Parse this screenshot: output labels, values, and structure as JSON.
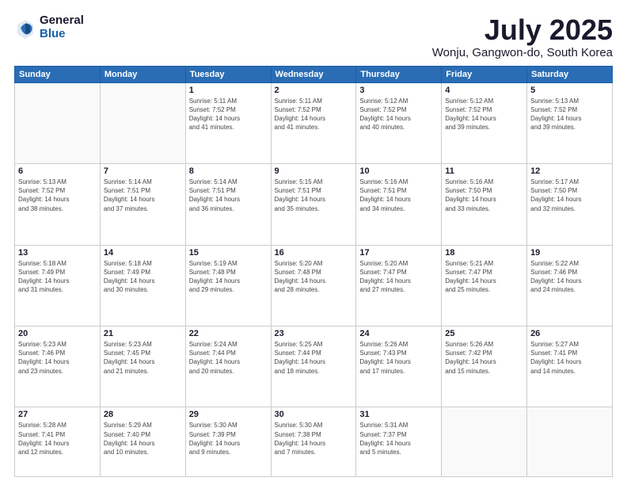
{
  "header": {
    "logo_general": "General",
    "logo_blue": "Blue",
    "month_title": "July 2025",
    "location": "Wonju, Gangwon-do, South Korea"
  },
  "weekdays": [
    "Sunday",
    "Monday",
    "Tuesday",
    "Wednesday",
    "Thursday",
    "Friday",
    "Saturday"
  ],
  "weeks": [
    [
      {
        "day": "",
        "info": ""
      },
      {
        "day": "",
        "info": ""
      },
      {
        "day": "1",
        "info": "Sunrise: 5:11 AM\nSunset: 7:52 PM\nDaylight: 14 hours\nand 41 minutes."
      },
      {
        "day": "2",
        "info": "Sunrise: 5:11 AM\nSunset: 7:52 PM\nDaylight: 14 hours\nand 41 minutes."
      },
      {
        "day": "3",
        "info": "Sunrise: 5:12 AM\nSunset: 7:52 PM\nDaylight: 14 hours\nand 40 minutes."
      },
      {
        "day": "4",
        "info": "Sunrise: 5:12 AM\nSunset: 7:52 PM\nDaylight: 14 hours\nand 39 minutes."
      },
      {
        "day": "5",
        "info": "Sunrise: 5:13 AM\nSunset: 7:52 PM\nDaylight: 14 hours\nand 39 minutes."
      }
    ],
    [
      {
        "day": "6",
        "info": "Sunrise: 5:13 AM\nSunset: 7:52 PM\nDaylight: 14 hours\nand 38 minutes."
      },
      {
        "day": "7",
        "info": "Sunrise: 5:14 AM\nSunset: 7:51 PM\nDaylight: 14 hours\nand 37 minutes."
      },
      {
        "day": "8",
        "info": "Sunrise: 5:14 AM\nSunset: 7:51 PM\nDaylight: 14 hours\nand 36 minutes."
      },
      {
        "day": "9",
        "info": "Sunrise: 5:15 AM\nSunset: 7:51 PM\nDaylight: 14 hours\nand 35 minutes."
      },
      {
        "day": "10",
        "info": "Sunrise: 5:16 AM\nSunset: 7:51 PM\nDaylight: 14 hours\nand 34 minutes."
      },
      {
        "day": "11",
        "info": "Sunrise: 5:16 AM\nSunset: 7:50 PM\nDaylight: 14 hours\nand 33 minutes."
      },
      {
        "day": "12",
        "info": "Sunrise: 5:17 AM\nSunset: 7:50 PM\nDaylight: 14 hours\nand 32 minutes."
      }
    ],
    [
      {
        "day": "13",
        "info": "Sunrise: 5:18 AM\nSunset: 7:49 PM\nDaylight: 14 hours\nand 31 minutes."
      },
      {
        "day": "14",
        "info": "Sunrise: 5:18 AM\nSunset: 7:49 PM\nDaylight: 14 hours\nand 30 minutes."
      },
      {
        "day": "15",
        "info": "Sunrise: 5:19 AM\nSunset: 7:48 PM\nDaylight: 14 hours\nand 29 minutes."
      },
      {
        "day": "16",
        "info": "Sunrise: 5:20 AM\nSunset: 7:48 PM\nDaylight: 14 hours\nand 28 minutes."
      },
      {
        "day": "17",
        "info": "Sunrise: 5:20 AM\nSunset: 7:47 PM\nDaylight: 14 hours\nand 27 minutes."
      },
      {
        "day": "18",
        "info": "Sunrise: 5:21 AM\nSunset: 7:47 PM\nDaylight: 14 hours\nand 25 minutes."
      },
      {
        "day": "19",
        "info": "Sunrise: 5:22 AM\nSunset: 7:46 PM\nDaylight: 14 hours\nand 24 minutes."
      }
    ],
    [
      {
        "day": "20",
        "info": "Sunrise: 5:23 AM\nSunset: 7:46 PM\nDaylight: 14 hours\nand 23 minutes."
      },
      {
        "day": "21",
        "info": "Sunrise: 5:23 AM\nSunset: 7:45 PM\nDaylight: 14 hours\nand 21 minutes."
      },
      {
        "day": "22",
        "info": "Sunrise: 5:24 AM\nSunset: 7:44 PM\nDaylight: 14 hours\nand 20 minutes."
      },
      {
        "day": "23",
        "info": "Sunrise: 5:25 AM\nSunset: 7:44 PM\nDaylight: 14 hours\nand 18 minutes."
      },
      {
        "day": "24",
        "info": "Sunrise: 5:26 AM\nSunset: 7:43 PM\nDaylight: 14 hours\nand 17 minutes."
      },
      {
        "day": "25",
        "info": "Sunrise: 5:26 AM\nSunset: 7:42 PM\nDaylight: 14 hours\nand 15 minutes."
      },
      {
        "day": "26",
        "info": "Sunrise: 5:27 AM\nSunset: 7:41 PM\nDaylight: 14 hours\nand 14 minutes."
      }
    ],
    [
      {
        "day": "27",
        "info": "Sunrise: 5:28 AM\nSunset: 7:41 PM\nDaylight: 14 hours\nand 12 minutes."
      },
      {
        "day": "28",
        "info": "Sunrise: 5:29 AM\nSunset: 7:40 PM\nDaylight: 14 hours\nand 10 minutes."
      },
      {
        "day": "29",
        "info": "Sunrise: 5:30 AM\nSunset: 7:39 PM\nDaylight: 14 hours\nand 9 minutes."
      },
      {
        "day": "30",
        "info": "Sunrise: 5:30 AM\nSunset: 7:38 PM\nDaylight: 14 hours\nand 7 minutes."
      },
      {
        "day": "31",
        "info": "Sunrise: 5:31 AM\nSunset: 7:37 PM\nDaylight: 14 hours\nand 5 minutes."
      },
      {
        "day": "",
        "info": ""
      },
      {
        "day": "",
        "info": ""
      }
    ]
  ]
}
